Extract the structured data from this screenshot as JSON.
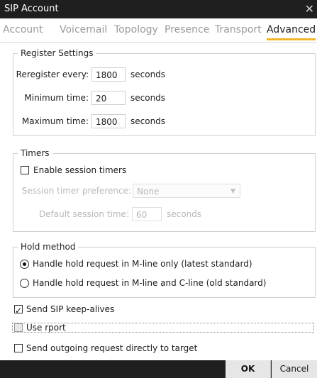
{
  "window": {
    "title": "SIP Account",
    "close_glyph": "✕"
  },
  "tabs": [
    {
      "label": "Account"
    },
    {
      "label": "Voicemail"
    },
    {
      "label": "Topology"
    },
    {
      "label": "Presence"
    },
    {
      "label": "Transport"
    },
    {
      "label": "Advanced"
    }
  ],
  "register": {
    "legend": "Register Settings",
    "reregister_label": "Reregister every:",
    "reregister_value": "1800",
    "minimum_label": "Minimum time:",
    "minimum_value": "20",
    "maximum_label": "Maximum time:",
    "maximum_value": "1800",
    "unit": "seconds"
  },
  "timers": {
    "legend": "Timers",
    "enable_label": "Enable session timers",
    "enable_checked": false,
    "preference_label": "Session timer preference:",
    "preference_value": "None",
    "default_label": "Default session time:",
    "default_value": "60",
    "unit": "seconds"
  },
  "hold": {
    "legend": "Hold method",
    "option1": "Handle hold request in M-line only (latest standard)",
    "option2": "Handle hold request in M-line and C-line (old standard)",
    "selected": 1
  },
  "options": {
    "keepalive_label": "Send SIP keep-alives",
    "keepalive_checked": true,
    "rport_label": "Use rport",
    "rport_checked": false,
    "direct_label": "Send outgoing request directly to target",
    "direct_checked": false
  },
  "buttons": {
    "ok": "OK",
    "cancel": "Cancel"
  },
  "colors": {
    "active_tab_underline": "#f0b428",
    "titlebar": "#1f1f1f"
  }
}
